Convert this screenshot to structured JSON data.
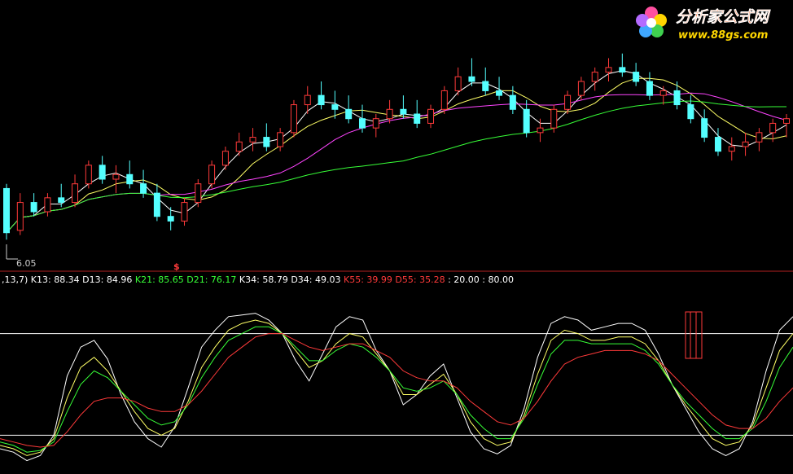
{
  "watermark": {
    "title": "分析家公式网",
    "url": "www.88gs.com"
  },
  "chart_data": [
    {
      "type": "candlestick",
      "panel": "price",
      "low_marker": "6.05",
      "signal_marker": "$",
      "up_color": "#ff3a3a",
      "down_color": "#54ffff",
      "candles": [
        [
          7.0,
          7.1,
          5.9,
          6.05
        ],
        [
          6.1,
          6.9,
          6.0,
          6.7
        ],
        [
          6.7,
          6.9,
          6.4,
          6.5
        ],
        [
          6.5,
          6.9,
          6.4,
          6.8
        ],
        [
          6.8,
          7.1,
          6.6,
          6.7
        ],
        [
          6.7,
          7.3,
          6.6,
          7.1
        ],
        [
          7.1,
          7.6,
          7.0,
          7.5
        ],
        [
          7.5,
          7.7,
          7.1,
          7.2
        ],
        [
          7.2,
          7.5,
          6.9,
          7.3
        ],
        [
          7.3,
          7.6,
          7.0,
          7.1
        ],
        [
          7.1,
          7.4,
          6.8,
          6.9
        ],
        [
          6.9,
          7.1,
          6.3,
          6.4
        ],
        [
          6.4,
          6.6,
          6.1,
          6.3
        ],
        [
          6.3,
          6.8,
          6.2,
          6.7
        ],
        [
          6.7,
          7.2,
          6.6,
          7.1
        ],
        [
          7.1,
          7.6,
          7.0,
          7.5
        ],
        [
          7.5,
          7.9,
          7.4,
          7.8
        ],
        [
          7.8,
          8.2,
          7.7,
          8.0
        ],
        [
          8.0,
          8.3,
          7.8,
          8.1
        ],
        [
          8.1,
          8.4,
          7.8,
          7.9
        ],
        [
          7.9,
          8.3,
          7.8,
          8.2
        ],
        [
          8.2,
          8.9,
          8.1,
          8.8
        ],
        [
          8.8,
          9.2,
          8.6,
          9.0
        ],
        [
          9.0,
          9.3,
          8.7,
          8.8
        ],
        [
          8.8,
          9.1,
          8.5,
          8.7
        ],
        [
          8.7,
          9.0,
          8.4,
          8.5
        ],
        [
          8.5,
          8.8,
          8.2,
          8.3
        ],
        [
          8.3,
          8.6,
          8.1,
          8.5
        ],
        [
          8.5,
          8.9,
          8.4,
          8.7
        ],
        [
          8.7,
          9.0,
          8.5,
          8.6
        ],
        [
          8.6,
          8.9,
          8.3,
          8.4
        ],
        [
          8.4,
          8.8,
          8.3,
          8.7
        ],
        [
          8.7,
          9.2,
          8.6,
          9.1
        ],
        [
          9.1,
          9.6,
          9.0,
          9.4
        ],
        [
          9.4,
          9.8,
          9.2,
          9.3
        ],
        [
          9.3,
          9.6,
          9.0,
          9.1
        ],
        [
          9.1,
          9.4,
          8.9,
          9.0
        ],
        [
          9.0,
          9.2,
          8.6,
          8.7
        ],
        [
          8.7,
          8.9,
          8.1,
          8.2
        ],
        [
          8.2,
          8.5,
          8.0,
          8.3
        ],
        [
          8.3,
          8.8,
          8.2,
          8.7
        ],
        [
          8.7,
          9.1,
          8.6,
          9.0
        ],
        [
          9.0,
          9.4,
          8.9,
          9.3
        ],
        [
          9.3,
          9.6,
          9.1,
          9.5
        ],
        [
          9.5,
          9.8,
          9.3,
          9.6
        ],
        [
          9.6,
          9.9,
          9.4,
          9.5
        ],
        [
          9.5,
          9.7,
          9.2,
          9.3
        ],
        [
          9.3,
          9.5,
          8.9,
          9.0
        ],
        [
          9.0,
          9.2,
          8.8,
          9.1
        ],
        [
          9.1,
          9.3,
          8.7,
          8.8
        ],
        [
          8.8,
          9.0,
          8.4,
          8.5
        ],
        [
          8.5,
          8.7,
          8.0,
          8.1
        ],
        [
          8.1,
          8.3,
          7.7,
          7.8
        ],
        [
          7.8,
          8.1,
          7.6,
          7.9
        ],
        [
          7.9,
          8.2,
          7.7,
          8.0
        ],
        [
          8.0,
          8.3,
          7.8,
          8.2
        ],
        [
          8.2,
          8.5,
          8.0,
          8.4
        ],
        [
          8.4,
          8.6,
          8.1,
          8.5
        ]
      ]
    },
    {
      "type": "line",
      "panel": "kd-oscillator",
      "ylim": [
        0,
        100
      ],
      "reference_lines": [
        20,
        80
      ],
      "legend": [
        {
          "label": ",13,7)",
          "value": "",
          "color": "#ffffff"
        },
        {
          "label": "K13:",
          "value": "88.34",
          "color": "#ffffff"
        },
        {
          "label": "D13:",
          "value": "84.96",
          "color": "#ffffff"
        },
        {
          "label": "K21:",
          "value": "85.65",
          "color": "#37ff37"
        },
        {
          "label": "D21:",
          "value": "76.17",
          "color": "#37ff37"
        },
        {
          "label": "K34:",
          "value": "58.79",
          "color": "#ffffff"
        },
        {
          "label": "D34:",
          "value": "49.03",
          "color": "#ffffff"
        },
        {
          "label": "K55:",
          "value": "39.99",
          "color": "#ff3a3a"
        },
        {
          "label": "D55:",
          "value": "35.28",
          "color": "#ff3a3a"
        },
        {
          "label": ":",
          "value": "20.00",
          "color": "#ffffff"
        },
        {
          "label": ":",
          "value": "80.00",
          "color": "#ffffff"
        }
      ],
      "series": [
        {
          "color": "#ffffff",
          "values": [
            12,
            10,
            5,
            8,
            20,
            55,
            72,
            76,
            65,
            44,
            28,
            18,
            13,
            25,
            48,
            72,
            82,
            90,
            91,
            92,
            88,
            80,
            64,
            52,
            68,
            84,
            90,
            88,
            70,
            58,
            38,
            44,
            55,
            62,
            42,
            22,
            12,
            9,
            14,
            36,
            66,
            86,
            90,
            88,
            82,
            84,
            86,
            86,
            82,
            68,
            50,
            36,
            22,
            12,
            8,
            12,
            28,
            58,
            82,
            90
          ]
        },
        {
          "color": "#ffff66",
          "values": [
            14,
            12,
            8,
            10,
            18,
            42,
            60,
            66,
            58,
            46,
            34,
            24,
            20,
            24,
            40,
            60,
            72,
            82,
            86,
            88,
            86,
            80,
            70,
            60,
            64,
            74,
            80,
            78,
            68,
            58,
            44,
            44,
            50,
            56,
            44,
            28,
            18,
            14,
            16,
            32,
            56,
            76,
            82,
            80,
            76,
            76,
            78,
            78,
            74,
            64,
            50,
            38,
            28,
            18,
            14,
            16,
            26,
            48,
            70,
            80
          ]
        },
        {
          "color": "#37ff37",
          "values": [
            16,
            14,
            10,
            11,
            16,
            34,
            50,
            58,
            54,
            46,
            38,
            30,
            26,
            28,
            38,
            54,
            66,
            76,
            80,
            84,
            84,
            80,
            72,
            64,
            64,
            70,
            74,
            72,
            66,
            58,
            48,
            46,
            48,
            52,
            44,
            32,
            24,
            18,
            18,
            30,
            50,
            68,
            76,
            76,
            74,
            74,
            74,
            74,
            70,
            62,
            50,
            40,
            32,
            24,
            18,
            18,
            24,
            40,
            60,
            72
          ]
        },
        {
          "color": "#ff3a3a",
          "values": [
            18,
            16,
            14,
            13,
            14,
            22,
            32,
            40,
            42,
            42,
            40,
            36,
            34,
            34,
            38,
            46,
            56,
            66,
            72,
            78,
            80,
            80,
            76,
            72,
            70,
            72,
            74,
            74,
            70,
            66,
            58,
            54,
            52,
            52,
            48,
            40,
            34,
            28,
            26,
            30,
            40,
            52,
            62,
            66,
            68,
            70,
            70,
            70,
            68,
            64,
            56,
            48,
            40,
            32,
            26,
            24,
            24,
            30,
            40,
            48
          ]
        }
      ]
    }
  ]
}
